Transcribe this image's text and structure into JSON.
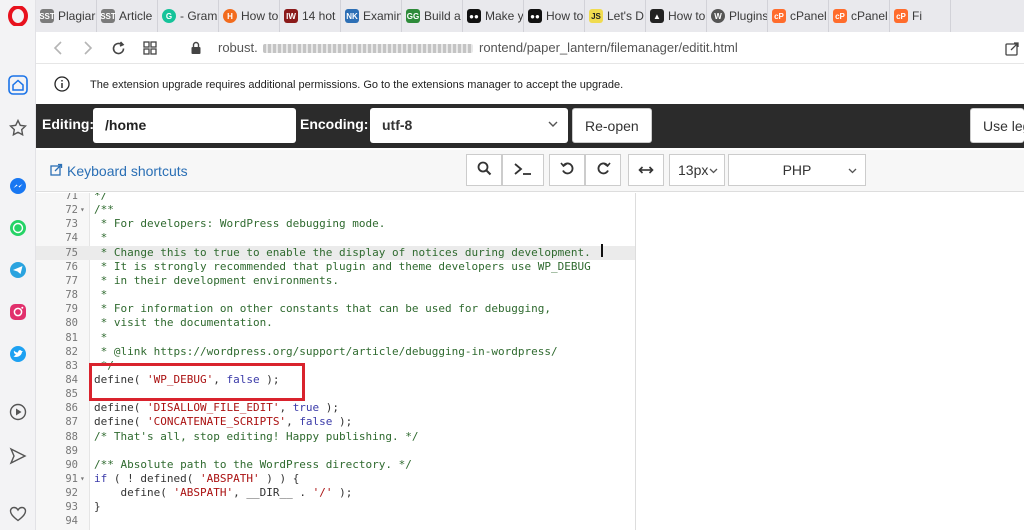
{
  "tabs": [
    {
      "label": "Plagiari",
      "icon": "sst-icon",
      "color": "#7b7b7b"
    },
    {
      "label": "Article",
      "icon": "sst-icon",
      "color": "#7b7b7b"
    },
    {
      "label": "- Gram",
      "icon": "grammarly-icon",
      "color": "#15c39a"
    },
    {
      "label": "How to",
      "icon": "orange-circle-icon",
      "color": "#f26b1d"
    },
    {
      "label": "14 hot",
      "icon": "iw-icon",
      "color": "#8b1a1a"
    },
    {
      "label": "Examin",
      "icon": "nk-icon",
      "color": "#2d6fb5"
    },
    {
      "label": "Build a",
      "icon": "gg-icon",
      "color": "#2e8b3a"
    },
    {
      "label": "Make y",
      "icon": "medium-icon",
      "color": "#111111"
    },
    {
      "label": "How to",
      "icon": "medium-icon",
      "color": "#111111"
    },
    {
      "label": "Let's D",
      "icon": "js-icon",
      "color": "#f0db4f"
    },
    {
      "label": "How to",
      "icon": "triangle-icon",
      "color": "#222222"
    },
    {
      "label": "Plugins",
      "icon": "wordpress-icon",
      "color": "#555555"
    },
    {
      "label": "cPanel",
      "icon": "cpanel-icon",
      "color": "#ff6c2c"
    },
    {
      "label": "cPanel",
      "icon": "cpanel-icon",
      "color": "#ff6c2c"
    },
    {
      "label": "Fi",
      "icon": "cpanel-icon",
      "color": "#ff6c2c"
    }
  ],
  "address": {
    "left": "robust.",
    "right": "rontend/paper_lantern/filemanager/editit.html"
  },
  "notice": "The extension upgrade requires additional permissions. Go to the extensions manager to accept the upgrade.",
  "editor_bar": {
    "editing_label": "Editing:",
    "path": "/home",
    "encoding_label": "Encoding:",
    "encoding_value": "utf-8",
    "reopen": "Re-open",
    "use_legacy": "Use leg"
  },
  "sub_bar": {
    "keyboard_shortcuts": "Keyboard shortcuts",
    "font_size": "13px",
    "mode": "PHP"
  },
  "colors": {
    "toolbar_bg": "#2b2b2b",
    "highlight": "#d9232d",
    "link": "#2a6fb5"
  },
  "code_lines": [
    {
      "n": "71",
      "fold": "",
      "parts": [
        [
          "com",
          "*/"
        ]
      ]
    },
    {
      "n": "72",
      "fold": "▾",
      "parts": [
        [
          "com",
          "/**"
        ]
      ]
    },
    {
      "n": "73",
      "fold": "",
      "parts": [
        [
          "com",
          " * For developers: WordPress debugging mode."
        ]
      ]
    },
    {
      "n": "74",
      "fold": "",
      "parts": [
        [
          "com",
          " *"
        ]
      ]
    },
    {
      "n": "75",
      "fold": "",
      "active": true,
      "parts": [
        [
          "com",
          " * Change this to true to enable the display of notices during development."
        ]
      ]
    },
    {
      "n": "76",
      "fold": "",
      "parts": [
        [
          "com",
          " * It is strongly recommended that plugin and theme developers use WP_DEBUG"
        ]
      ]
    },
    {
      "n": "77",
      "fold": "",
      "parts": [
        [
          "com",
          " * in their development environments."
        ]
      ]
    },
    {
      "n": "78",
      "fold": "",
      "parts": [
        [
          "com",
          " *"
        ]
      ]
    },
    {
      "n": "79",
      "fold": "",
      "parts": [
        [
          "com",
          " * For information on other constants that can be used for debugging,"
        ]
      ]
    },
    {
      "n": "80",
      "fold": "",
      "parts": [
        [
          "com",
          " * visit the documentation."
        ]
      ]
    },
    {
      "n": "81",
      "fold": "",
      "parts": [
        [
          "com",
          " *"
        ]
      ]
    },
    {
      "n": "82",
      "fold": "",
      "parts": [
        [
          "com",
          " * @link https://wordpress.org/support/article/debugging-in-wordpress/"
        ]
      ]
    },
    {
      "n": "83",
      "fold": "",
      "parts": [
        [
          "com",
          " */"
        ]
      ]
    },
    {
      "n": "84",
      "fold": "",
      "parts": [
        [
          "fn",
          "define( "
        ],
        [
          "str",
          "'WP_DEBUG'"
        ],
        [
          "fn",
          ", "
        ],
        [
          "kw",
          "false"
        ],
        [
          "fn",
          " );"
        ]
      ]
    },
    {
      "n": "85",
      "fold": "",
      "parts": []
    },
    {
      "n": "86",
      "fold": "",
      "parts": [
        [
          "fn",
          "define( "
        ],
        [
          "str",
          "'DISALLOW_FILE_EDIT'"
        ],
        [
          "fn",
          ", "
        ],
        [
          "kw",
          "true"
        ],
        [
          "fn",
          " );"
        ]
      ]
    },
    {
      "n": "87",
      "fold": "",
      "parts": [
        [
          "fn",
          "define( "
        ],
        [
          "str",
          "'CONCATENATE_SCRIPTS'"
        ],
        [
          "fn",
          ", "
        ],
        [
          "kw",
          "false"
        ],
        [
          "fn",
          " );"
        ]
      ]
    },
    {
      "n": "88",
      "fold": "",
      "parts": [
        [
          "com",
          "/* That's all, stop editing! Happy publishing. */"
        ]
      ]
    },
    {
      "n": "89",
      "fold": "",
      "parts": []
    },
    {
      "n": "90",
      "fold": "",
      "parts": [
        [
          "com",
          "/** Absolute path to the WordPress directory. */"
        ]
      ]
    },
    {
      "n": "91",
      "fold": "▾",
      "parts": [
        [
          "kw",
          "if"
        ],
        [
          "fn",
          " ( ! defined( "
        ],
        [
          "str",
          "'ABSPATH'"
        ],
        [
          "fn",
          " ) ) {"
        ]
      ]
    },
    {
      "n": "92",
      "fold": "",
      "parts": [
        [
          "fn",
          "    define( "
        ],
        [
          "str",
          "'ABSPATH'"
        ],
        [
          "fn",
          ", __DIR__ . "
        ],
        [
          "str",
          "'/'"
        ],
        [
          "fn",
          " );"
        ]
      ]
    },
    {
      "n": "93",
      "fold": "",
      "parts": [
        [
          "fn",
          "}"
        ]
      ]
    },
    {
      "n": "94",
      "fold": "",
      "parts": []
    }
  ]
}
